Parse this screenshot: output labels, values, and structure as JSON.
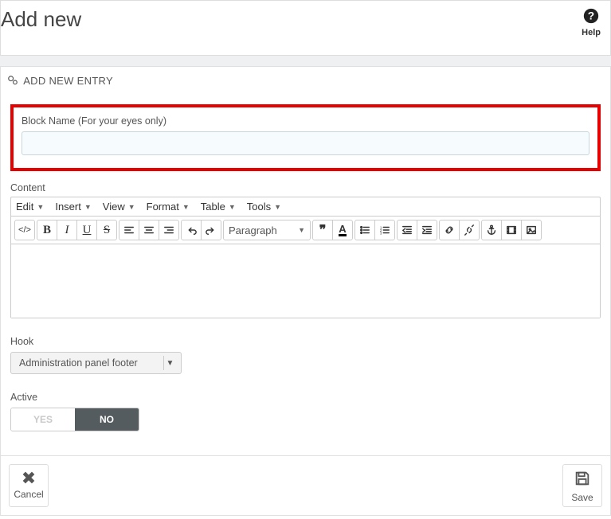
{
  "header": {
    "title": "Add new",
    "help_label": "Help"
  },
  "panel": {
    "heading": "ADD NEW ENTRY",
    "block_name_label": "Block Name (For your eyes only)",
    "block_name_value": "",
    "content_label": "Content",
    "hook_label": "Hook",
    "hook_value": "Administration panel footer",
    "active_label": "Active",
    "active_yes": "YES",
    "active_no": "NO"
  },
  "editor": {
    "menus": {
      "edit": "Edit",
      "insert": "Insert",
      "view": "View",
      "format": "Format",
      "table": "Table",
      "tools": "Tools"
    },
    "format_select": "Paragraph"
  },
  "footer": {
    "cancel": "Cancel",
    "save": "Save"
  }
}
